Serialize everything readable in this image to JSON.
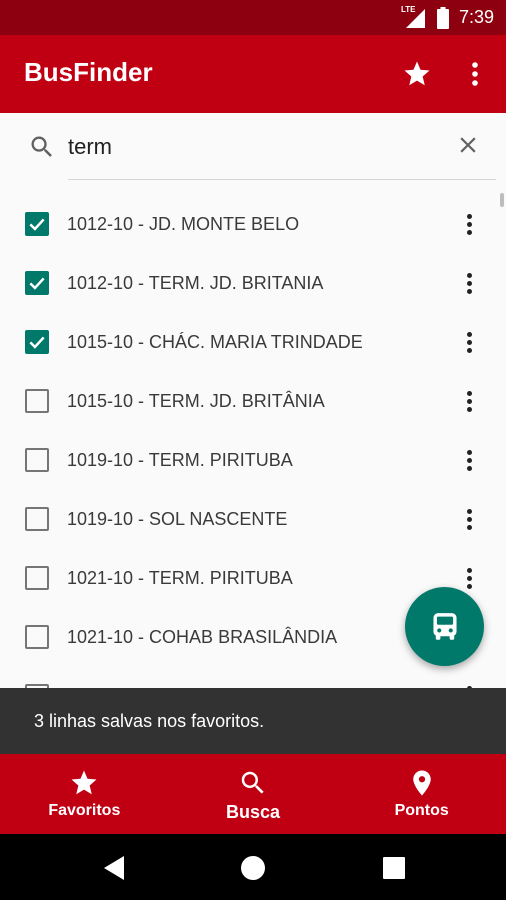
{
  "status_bar": {
    "network": "LTE",
    "time": "7:39"
  },
  "app_bar": {
    "title": "BusFinder",
    "favorite_icon": "star-icon",
    "overflow_icon": "more-vert-icon"
  },
  "search": {
    "value": "term",
    "icon": "search-icon",
    "clear_icon": "close-icon"
  },
  "lines": [
    {
      "label": "1012-10 - JD. MONTE BELO",
      "checked": true
    },
    {
      "label": "1012-10 - TERM. JD. BRITANIA",
      "checked": true
    },
    {
      "label": "1015-10 - CHÁC. MARIA TRINDADE",
      "checked": true
    },
    {
      "label": "1015-10 - TERM. JD. BRITÂNIA",
      "checked": false
    },
    {
      "label": "1019-10 - TERM. PIRITUBA",
      "checked": false
    },
    {
      "label": "1019-10 - SOL NASCENTE",
      "checked": false
    },
    {
      "label": "1021-10 - TERM. PIRITUBA",
      "checked": false
    },
    {
      "label": "1021-10 - COHAB BRASILÂNDIA",
      "checked": false
    },
    {
      "label": "",
      "checked": false
    }
  ],
  "fab": {
    "icon": "bus-icon"
  },
  "snackbar": {
    "message": "3 linhas salvas nos favoritos."
  },
  "bottom_nav": [
    {
      "label": "Favoritos",
      "icon": "star-icon",
      "active": false
    },
    {
      "label": "Busca",
      "icon": "search-icon",
      "active": true
    },
    {
      "label": "Pontos",
      "icon": "location-pin-icon",
      "active": false
    }
  ],
  "colors": {
    "primary": "#c00012",
    "primary_dark": "#8d0010",
    "accent": "#00796b",
    "snackbar": "#323232"
  }
}
